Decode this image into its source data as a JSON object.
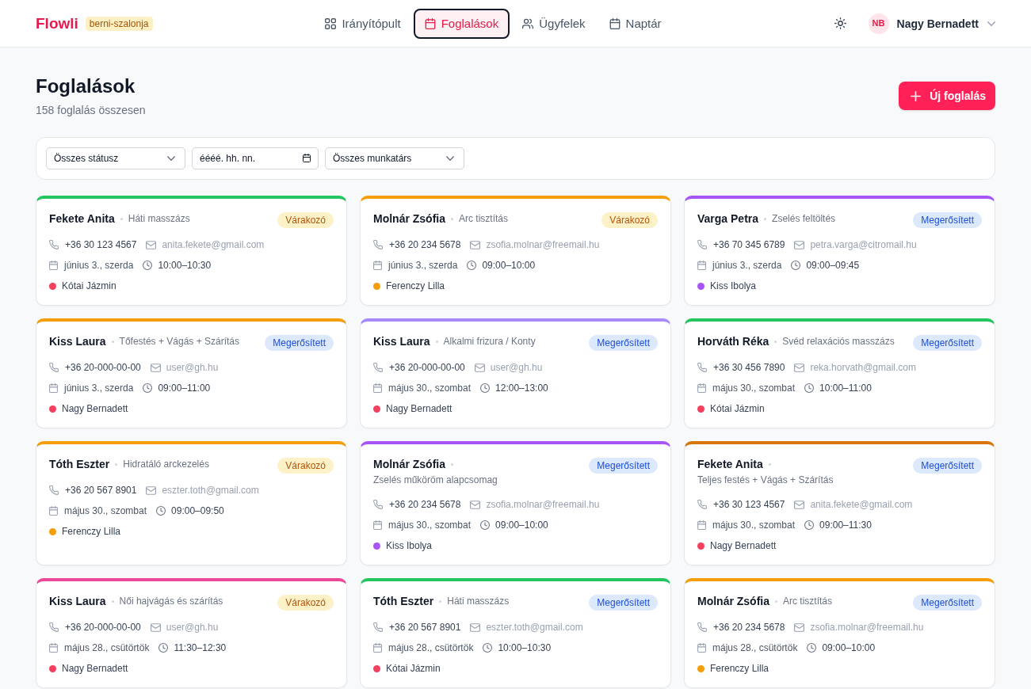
{
  "header": {
    "logo": "Flowli",
    "workspace": "berni-szalonja",
    "nav": [
      {
        "label": "Irányítópult",
        "selected": false
      },
      {
        "label": "Foglalások",
        "selected": true
      },
      {
        "label": "Ügyfelek",
        "selected": false
      },
      {
        "label": "Naptár",
        "selected": false
      }
    ],
    "user": {
      "initials": "NB",
      "name": "Nagy Bernadett"
    }
  },
  "page": {
    "title": "Foglalások",
    "subtitle": "158 foglalás összesen",
    "new_button": "Új foglalás"
  },
  "filters": [
    {
      "kind": "select",
      "value": "Összes státusz"
    },
    {
      "kind": "date",
      "placeholder": "éééé. hh. nn."
    },
    {
      "kind": "select",
      "value": "Összes munkatárs"
    }
  ],
  "bookings": [
    {
      "client": "Fekete Anita",
      "service": "Háti masszázs",
      "status": {
        "label": "Várakozó",
        "kind": "pending"
      },
      "color": "#22c55e",
      "phone": "+36 30 123 4567",
      "email": "anita.fekete@gmail.com",
      "date": "június 3., szerda",
      "time": "10:00–10:30",
      "staff": {
        "name": "Kótai Jázmin",
        "color": "#f43f5e"
      }
    },
    {
      "client": "Molnár Zsófia",
      "service": "Arc tisztítás",
      "status": {
        "label": "Várakozó",
        "kind": "pending"
      },
      "color": "#f59e0b",
      "phone": "+36 20 234 5678",
      "email": "zsofia.molnar@freemail.hu",
      "date": "június 3., szerda",
      "time": "09:00–10:00",
      "staff": {
        "name": "Ferenczy Lilla",
        "color": "#f59e0b"
      }
    },
    {
      "client": "Varga Petra",
      "service": "Zselés feltöltés",
      "status": {
        "label": "Megerősített",
        "kind": "confirmed"
      },
      "color": "#a855f7",
      "phone": "+36 70 345 6789",
      "email": "petra.varga@citromail.hu",
      "date": "június 3., szerda",
      "time": "09:00–09:45",
      "staff": {
        "name": "Kiss Ibolya",
        "color": "#a855f7"
      }
    },
    {
      "client": "Kiss Laura",
      "service": "Tőfestés + Vágás + Szárítás",
      "status": {
        "label": "Megerősített",
        "kind": "confirmed"
      },
      "color": "#f59e0b",
      "phone": "+36 20-000-00-00",
      "email": "user@gh.hu",
      "date": "június 3., szerda",
      "time": "09:00–11:00",
      "staff": {
        "name": "Nagy Bernadett",
        "color": "#f43f5e"
      }
    },
    {
      "client": "Kiss Laura",
      "service": "Alkalmi frizura / Konty",
      "status": {
        "label": "Megerősített",
        "kind": "confirmed"
      },
      "color": "#a78bfa",
      "phone": "+36 20-000-00-00",
      "email": "user@gh.hu",
      "date": "május 30., szombat",
      "time": "12:00–13:00",
      "staff": {
        "name": "Nagy Bernadett",
        "color": "#f43f5e"
      }
    },
    {
      "client": "Horváth Réka",
      "service": "Svéd relaxációs masszázs",
      "status": {
        "label": "Megerősített",
        "kind": "confirmed"
      },
      "color": "#22c55e",
      "phone": "+36 30 456 7890",
      "email": "reka.horvath@gmail.com",
      "date": "május 30., szombat",
      "time": "10:00–11:00",
      "staff": {
        "name": "Kótai Jázmin",
        "color": "#f43f5e"
      }
    },
    {
      "client": "Tóth Eszter",
      "service": "Hidratáló arckezelés",
      "status": {
        "label": "Várakozó",
        "kind": "pending"
      },
      "color": "#f59e0b",
      "phone": "+36 20 567 8901",
      "email": "eszter.toth@gmail.com",
      "date": "május 30., szombat",
      "time": "09:00–09:50",
      "staff": {
        "name": "Ferenczy Lilla",
        "color": "#f59e0b"
      }
    },
    {
      "client": "Molnár Zsófia",
      "service": "Zselés műköröm alapcsomag",
      "status": {
        "label": "Megerősített",
        "kind": "confirmed"
      },
      "color": "#a855f7",
      "phone": "+36 20 234 5678",
      "email": "zsofia.molnar@freemail.hu",
      "date": "május 30., szombat",
      "time": "09:00–10:00",
      "staff": {
        "name": "Kiss Ibolya",
        "color": "#a855f7"
      }
    },
    {
      "client": "Fekete Anita",
      "service": "Teljes festés + Vágás + Szárítás",
      "status": {
        "label": "Megerősített",
        "kind": "confirmed"
      },
      "color": "#d97706",
      "phone": "+36 30 123 4567",
      "email": "anita.fekete@gmail.com",
      "date": "május 30., szombat",
      "time": "09:00–11:30",
      "staff": {
        "name": "Nagy Bernadett",
        "color": "#f43f5e"
      }
    },
    {
      "client": "Kiss Laura",
      "service": "Női hajvágás és szárítás",
      "status": {
        "label": "Várakozó",
        "kind": "pending"
      },
      "color": "#ec4899",
      "phone": "+36 20-000-00-00",
      "email": "user@gh.hu",
      "date": "május 28., csütörtök",
      "time": "11:30–12:30",
      "staff": {
        "name": "Nagy Bernadett",
        "color": "#f43f5e"
      }
    },
    {
      "client": "Tóth Eszter",
      "service": "Háti masszázs",
      "status": {
        "label": "Megerősített",
        "kind": "confirmed"
      },
      "color": "#22c55e",
      "phone": "+36 20 567 8901",
      "email": "eszter.toth@gmail.com",
      "date": "május 28., csütörtök",
      "time": "10:00–10:30",
      "staff": {
        "name": "Kótai Jázmin",
        "color": "#f43f5e"
      }
    },
    {
      "client": "Molnár Zsófia",
      "service": "Arc tisztítás",
      "status": {
        "label": "Megerősített",
        "kind": "confirmed"
      },
      "color": "#f59e0b",
      "phone": "+36 20 234 5678",
      "email": "zsofia.molnar@freemail.hu",
      "date": "május 28., csütörtök",
      "time": "09:00–10:00",
      "staff": {
        "name": "Ferenczy Lilla",
        "color": "#f59e0b"
      }
    }
  ]
}
